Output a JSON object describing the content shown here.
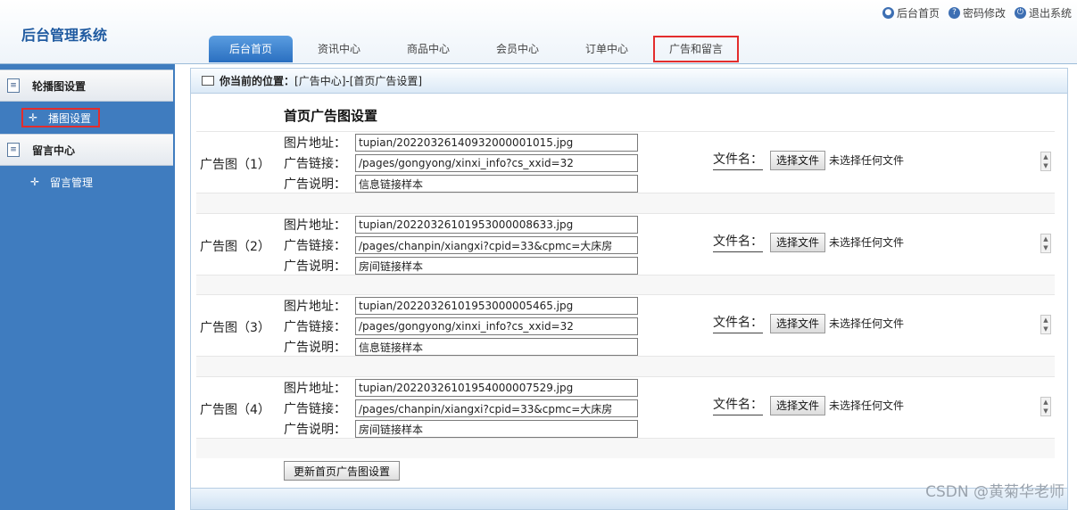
{
  "header": {
    "app_title": "后台管理系统",
    "top_links": [
      {
        "label": "后台首页",
        "icon": "user-icon"
      },
      {
        "label": "密码修改",
        "icon": "help-icon"
      },
      {
        "label": "退出系统",
        "icon": "power-icon"
      }
    ],
    "tabs": [
      {
        "label": "后台首页",
        "active": true
      },
      {
        "label": "资讯中心"
      },
      {
        "label": "商品中心"
      },
      {
        "label": "会员中心"
      },
      {
        "label": "订单中心"
      },
      {
        "label": "广告和留言",
        "highlighted": true
      }
    ]
  },
  "sidebar": {
    "groups": [
      {
        "label": "轮播图设置",
        "items": [
          {
            "label": "播图设置",
            "highlighted": true
          }
        ]
      },
      {
        "label": "留言中心",
        "items": [
          {
            "label": "留言管理"
          }
        ]
      }
    ]
  },
  "breadcrumb": {
    "label": "你当前的位置：",
    "path": "[广告中心]-[首页广告设置]"
  },
  "section_title": "首页广告图设置",
  "field_labels": {
    "image": "图片地址：",
    "link": "广告链接：",
    "desc": "广告说明：",
    "file": "文件名：",
    "choose_file": "选择文件",
    "no_file": "未选择任何文件"
  },
  "ads": [
    {
      "name": "广告图（1）",
      "image": "tupian/20220326140932000001015.jpg",
      "link": "/pages/gongyong/xinxi_info?cs_xxid=32",
      "desc": "信息链接样本"
    },
    {
      "name": "广告图（2）",
      "image": "tupian/20220326101953000008633.jpg",
      "link": "/pages/chanpin/xiangxi?cpid=33&cpmc=大床房",
      "desc": "房间链接样本"
    },
    {
      "name": "广告图（3）",
      "image": "tupian/20220326101953000005465.jpg",
      "link": "/pages/gongyong/xinxi_info?cs_xxid=32",
      "desc": "信息链接样本"
    },
    {
      "name": "广告图（4）",
      "image": "tupian/20220326101954000007529.jpg",
      "link": "/pages/chanpin/xiangxi?cpid=33&cpmc=大床房",
      "desc": "房间链接样本"
    }
  ],
  "update_button": "更新首页广告图设置",
  "watermark": "CSDN @黄菊华老师"
}
